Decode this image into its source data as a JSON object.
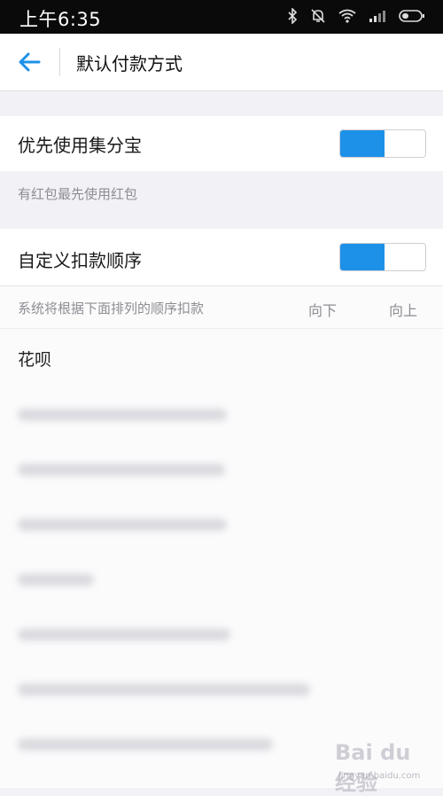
{
  "status_bar": {
    "time": "上午6:35"
  },
  "header": {
    "title": "默认付款方式"
  },
  "settings": {
    "jifenbao": {
      "label": "优先使用集分宝",
      "enabled": true,
      "hint": "有红包最先使用红包"
    },
    "custom_order": {
      "label": "自定义扣款顺序",
      "enabled": true,
      "hint": "系统将根据下面排列的顺序扣款",
      "down_label": "向下",
      "up_label": "向上"
    }
  },
  "payment_methods": {
    "first": "花呗"
  },
  "watermark": {
    "text": "Bai du 经验",
    "sub": "jingyan.baidu.com"
  }
}
